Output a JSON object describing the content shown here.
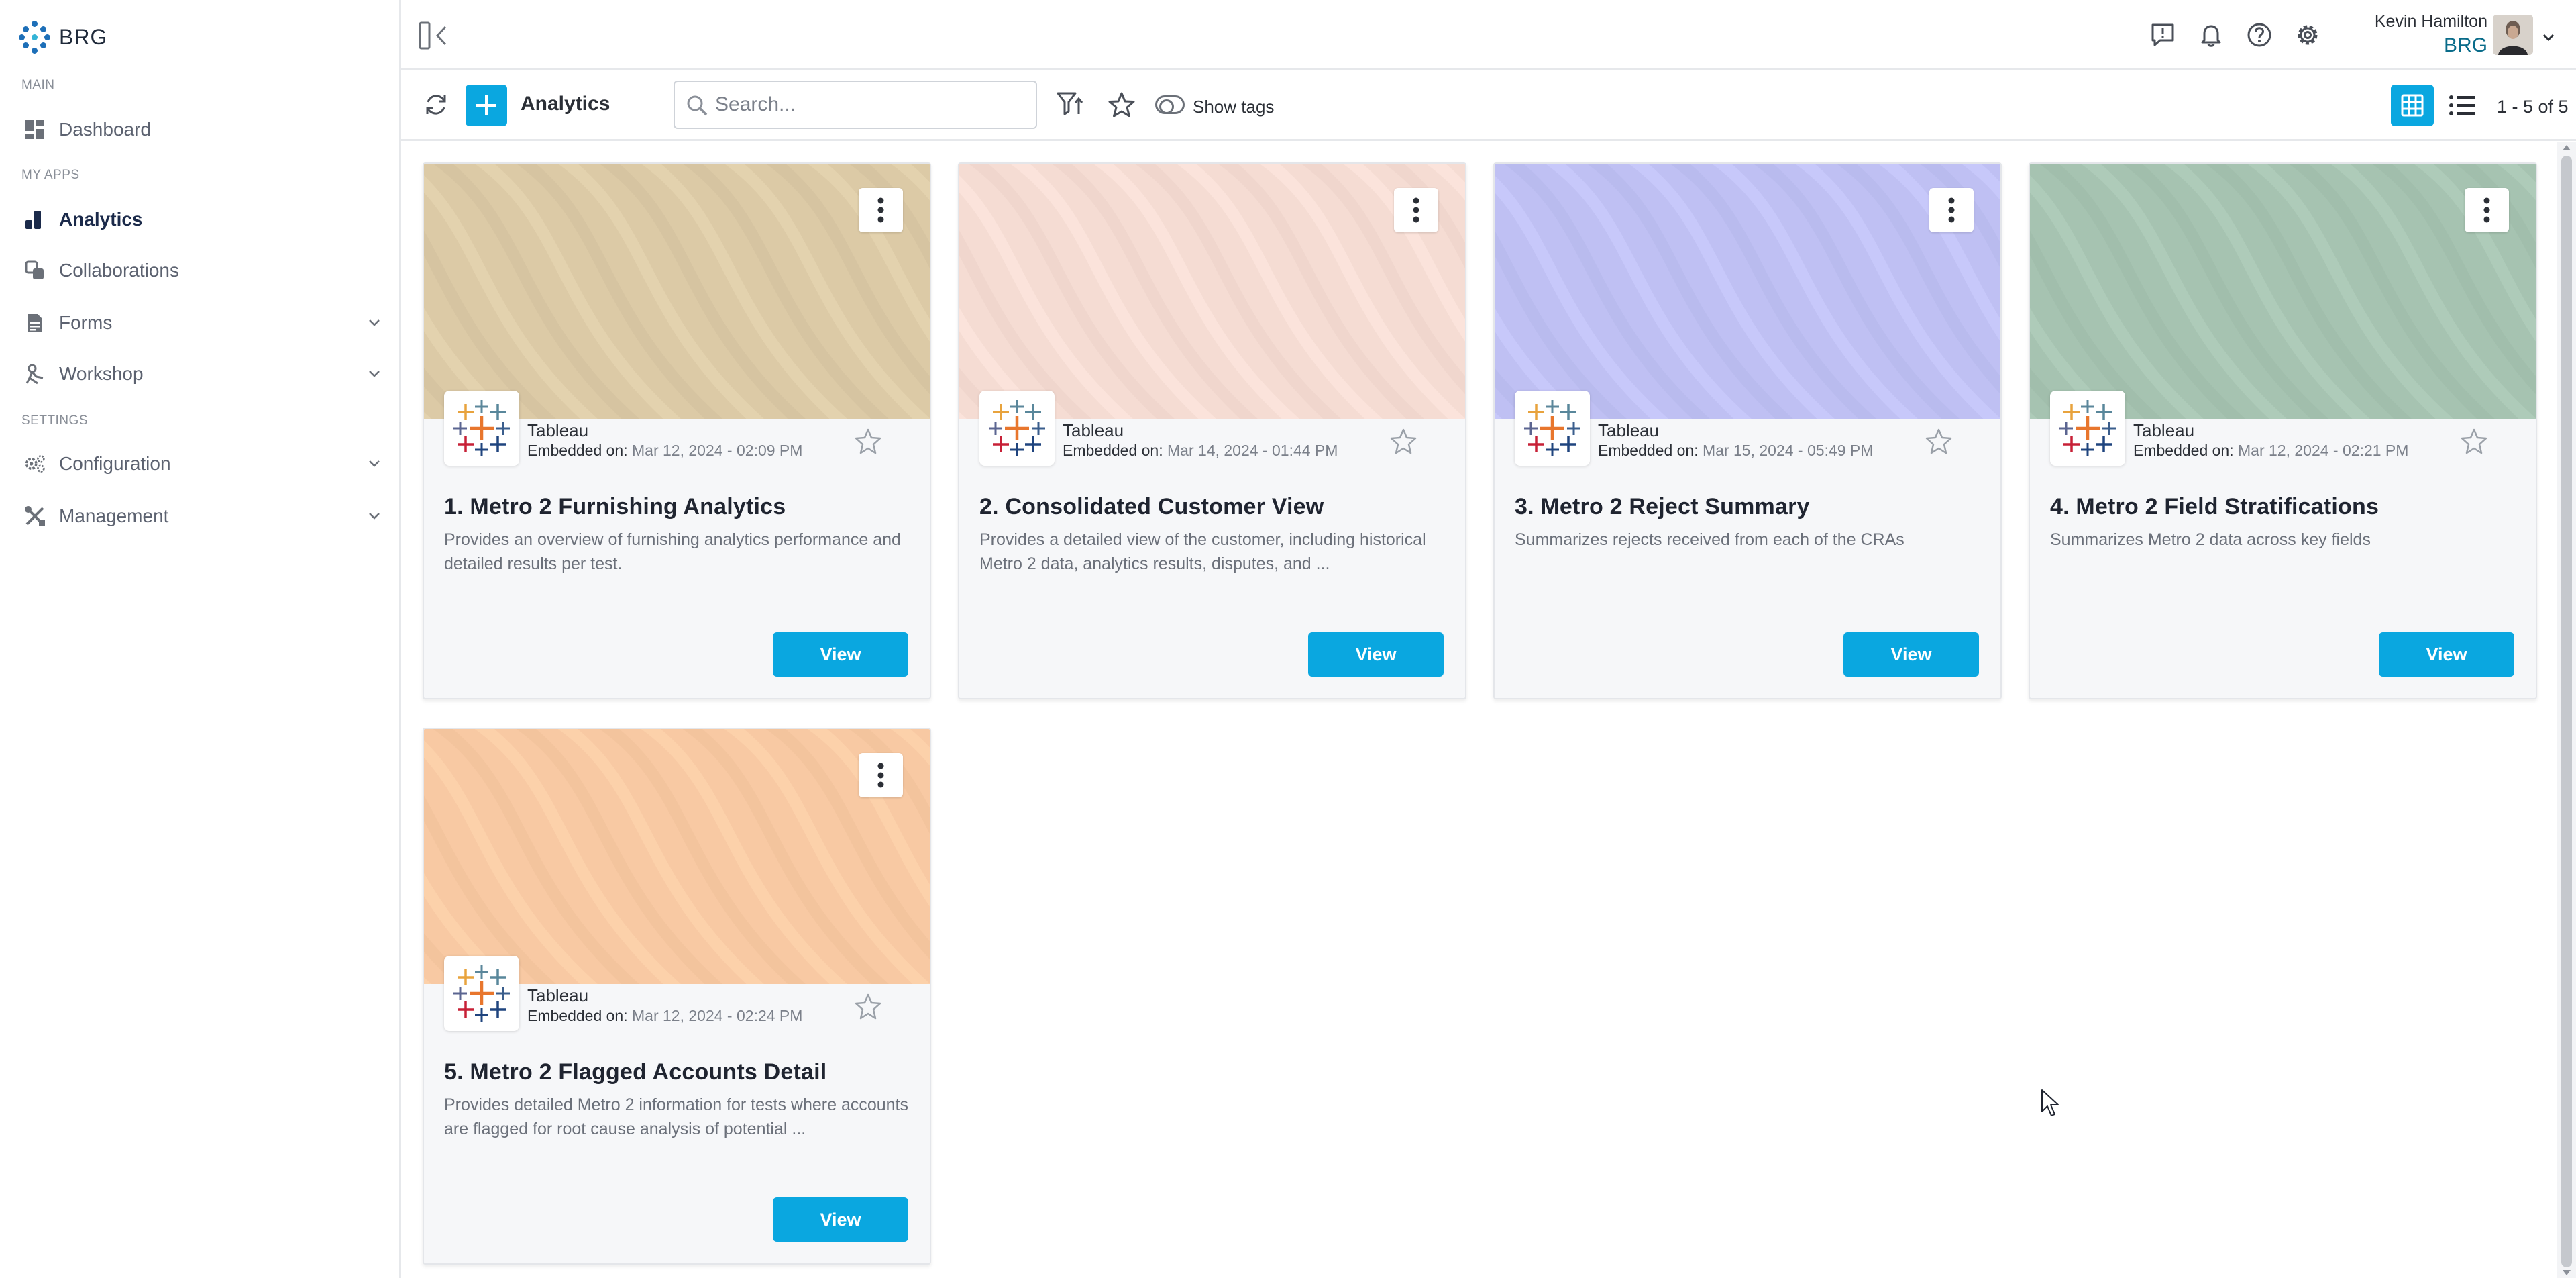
{
  "sidebar": {
    "brand": "BRG",
    "sections": {
      "main": "MAIN",
      "my_apps": "MY APPS",
      "settings": "SETTINGS"
    },
    "items": [
      {
        "label": "Dashboard",
        "icon": "dashboard-icon"
      },
      {
        "label": "Analytics",
        "icon": "analytics-icon",
        "active": true
      },
      {
        "label": "Collaborations",
        "icon": "collaborations-icon"
      },
      {
        "label": "Forms",
        "icon": "forms-icon",
        "expandable": true
      },
      {
        "label": "Workshop",
        "icon": "workshop-icon",
        "expandable": true
      },
      {
        "label": "Configuration",
        "icon": "configuration-icon",
        "expandable": true
      },
      {
        "label": "Management",
        "icon": "management-icon",
        "expandable": true
      }
    ]
  },
  "header": {
    "user_name": "Kevin Hamilton",
    "user_org": "BRG"
  },
  "toolbar": {
    "title": "Analytics",
    "search_placeholder": "Search...",
    "show_tags_label": "Show tags",
    "page_count": "1 - 5 of 5"
  },
  "cards": [
    {
      "platform": "Tableau",
      "embedded_label": "Embedded on:",
      "embedded_date": "Mar 12, 2024 - 02:09 PM",
      "title": "1. Metro 2 Furnishing Analytics",
      "description": "Provides an overview of furnishing analytics performance and detailed results per test.",
      "view_label": "View",
      "banner_color": "#dccaa6"
    },
    {
      "platform": "Tableau",
      "embedded_label": "Embedded on:",
      "embedded_date": "Mar 14, 2024 - 01:44 PM",
      "title": "2. Consolidated Customer View",
      "description": "Provides a detailed view of the customer, including historical Metro 2 data, analytics results, disputes, and ...",
      "view_label": "View",
      "banner_color": "#f5dcd3"
    },
    {
      "platform": "Tableau",
      "embedded_label": "Embedded on:",
      "embedded_date": "Mar 15, 2024 - 05:49 PM",
      "title": "3. Metro 2 Reject Summary",
      "description": "Summarizes rejects received from each of the CRAs",
      "view_label": "View",
      "banner_color": "#bfc0f3"
    },
    {
      "platform": "Tableau",
      "embedded_label": "Embedded on:",
      "embedded_date": "Mar 12, 2024 - 02:21 PM",
      "title": "4. Metro 2 Field Stratifications",
      "description": "Summarizes Metro 2 data across key fields",
      "view_label": "View",
      "banner_color": "#a6c3b1"
    },
    {
      "platform": "Tableau",
      "embedded_label": "Embedded on:",
      "embedded_date": "Mar 12, 2024 - 02:24 PM",
      "title": "5. Metro 2 Flagged Accounts Detail",
      "description": "Provides detailed Metro 2 information for tests where accounts are flagged for root cause analysis of potential ...",
      "view_label": "View",
      "banner_color": "#f8c9a3"
    }
  ],
  "colors": {
    "accent": "#0aa7e0",
    "brand_blue": "#1d6fb8",
    "org_text": "#0a6c8a"
  }
}
